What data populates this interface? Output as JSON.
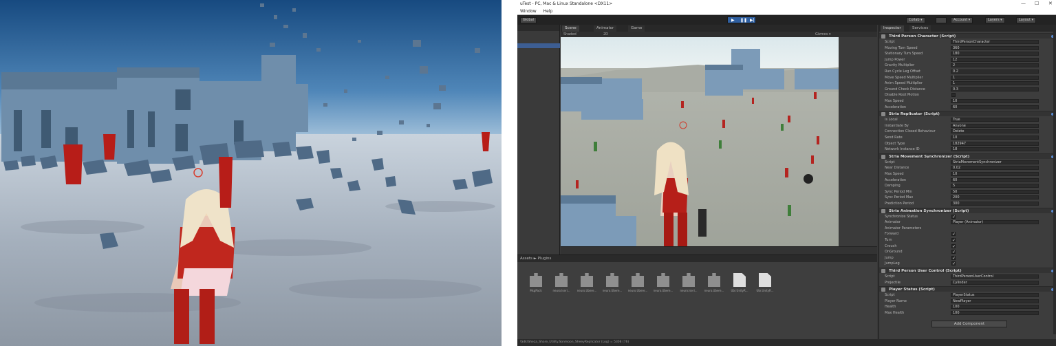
{
  "left_game_view": {
    "description_colors": {
      "sky_top": "#1b4f86",
      "sky_bottom": "#cfe1ee",
      "ground": "#aeb7c3",
      "building": "#7e9bb8"
    }
  },
  "unity_editor": {
    "window": {
      "title": "uTest - PC, Mac & Linux Standalone <DX11>",
      "controls": [
        "—",
        "☐",
        "✕"
      ]
    },
    "menu": [
      "Window",
      "Help"
    ],
    "toolbar": {
      "global_button": "Global",
      "collab": "Collab ▾",
      "account": "Account ▾",
      "layers": "Layers ▾",
      "layout": "Layout ▾"
    },
    "scene_tabs": [
      {
        "label": "Scene"
      },
      {
        "label": "Animator"
      },
      {
        "label": "Game"
      }
    ],
    "scene_bar": {
      "shaded": "Shaded",
      "mode": "2D",
      "gizmos": "Gizmos ▾"
    },
    "project": {
      "breadcrumb_root": "Assets",
      "breadcrumb_sep": "►",
      "breadcrumb_folder": "Plugins",
      "assets": [
        "MsgPack",
        "neuro.Iseri...",
        "neuro.Ubere...",
        "neuro.Ubere...",
        "neuro.Ubere...",
        "neuro.Ubere...",
        "neuro.Iseri...",
        "neuro.Ubere...",
        "Ubr.UnityR...",
        "Ubr.UnityR..."
      ]
    },
    "status_text": "\\Sdk\\Sheza_Share_Utility.Sonmoon_SheeyReplicator (Log) = 5308 (76)",
    "inspector": {
      "tabs": [
        "Inspector",
        "Services"
      ],
      "components": [
        {
          "name": "Third Person Character (Script)",
          "props": [
            {
              "label": "Script",
              "value": "ThirdPersonCharacter"
            },
            {
              "label": "Moving Turn Speed",
              "value": "360"
            },
            {
              "label": "Stationary Turn Speed",
              "value": "180"
            },
            {
              "label": "Jump Power",
              "value": "12"
            },
            {
              "label": "Gravity Multiplier",
              "value": "2"
            },
            {
              "label": "Run Cycle Leg Offset",
              "value": "0.2"
            },
            {
              "label": "Move Speed Multiplier",
              "value": "1"
            },
            {
              "label": "Anim Speed Multiplier",
              "value": "1"
            },
            {
              "label": "Ground Check Distance",
              "value": "0.3"
            },
            {
              "label": "Disable Root Motion",
              "value": ""
            },
            {
              "label": "Max Speed",
              "value": "10"
            },
            {
              "label": "Acceleration",
              "value": "60"
            }
          ]
        },
        {
          "name": "Stria Replicator (Script)",
          "props": [
            {
              "label": "Is Local",
              "value": "True"
            },
            {
              "label": "Instantiate By",
              "value": "Anyone"
            },
            {
              "label": "Connection Closed Behaviour",
              "value": "Delete"
            },
            {
              "label": "Send Rate",
              "value": "10"
            },
            {
              "label": "Object Type",
              "value": "182947"
            },
            {
              "label": "Network Instance ID",
              "value": "18"
            }
          ]
        },
        {
          "name": "Stria Movement Synchronizer (Script)",
          "props": [
            {
              "label": "Script",
              "value": "StriaMovementSynchronizer"
            },
            {
              "label": "Near Distance",
              "value": "0.02"
            },
            {
              "label": "Max Speed",
              "value": "10"
            },
            {
              "label": "Acceleration",
              "value": "60"
            },
            {
              "label": "Damping",
              "value": "5"
            },
            {
              "label": "Sync Period Min",
              "value": "50"
            },
            {
              "label": "Sync Period Max",
              "value": "200"
            },
            {
              "label": "Prediction Period",
              "value": "300"
            }
          ]
        },
        {
          "name": "Stria Animation Synchronizer (Script)",
          "props": [
            {
              "label": "Synchronize Status",
              "value": "✓"
            },
            {
              "label": "Animator",
              "value": "Player (Animator)"
            },
            {
              "label": "Animator Parameters",
              "value": ""
            },
            {
              "label": "Forward",
              "value": "✓"
            },
            {
              "label": "Turn",
              "value": "✓"
            },
            {
              "label": "Crouch",
              "value": "✓"
            },
            {
              "label": "OnGround",
              "value": "✓"
            },
            {
              "label": "Jump",
              "value": "✓"
            },
            {
              "label": "JumpLeg",
              "value": "✓"
            }
          ]
        },
        {
          "name": "Third Person User Control (Script)",
          "props": [
            {
              "label": "Script",
              "value": "ThirdPersonUserControl"
            },
            {
              "label": "Projectile",
              "value": "Cylinder"
            }
          ]
        },
        {
          "name": "Player Status (Script)",
          "props": [
            {
              "label": "Script",
              "value": "PlayerStatus"
            },
            {
              "label": "Player Name",
              "value": "NewPlayer"
            },
            {
              "label": "Health",
              "value": "100"
            },
            {
              "label": "Max Health",
              "value": "100"
            }
          ]
        }
      ],
      "add_component": "Add Component"
    }
  }
}
